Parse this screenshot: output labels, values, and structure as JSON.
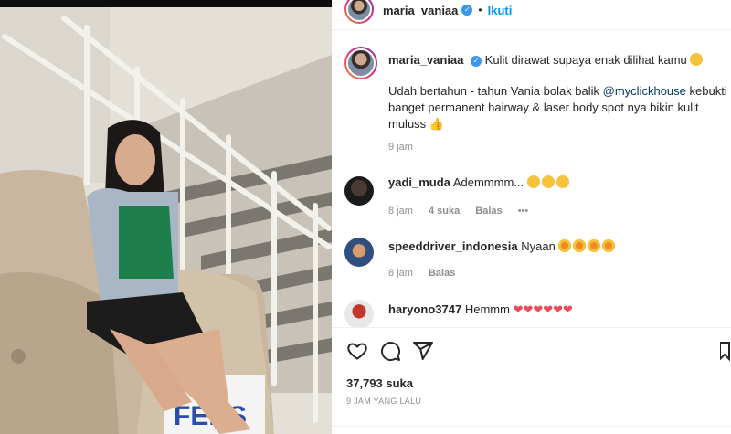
{
  "post": {
    "username": "maria_vaniaa",
    "follow_label": "Ikuti",
    "dot": "•",
    "caption_line1": "Kulit dirawat supaya enak dilihat kamu",
    "caption_p2_a": "Udah bertahun - tahun Vania bolak balik ",
    "caption_mention": "@myclickhouse",
    "caption_p2_b": " kebukti",
    "caption_line3": "banget permanent hairway & laser body spot nya bikin kulit",
    "caption_line4": "muluss",
    "caption_time": "9 jam",
    "likes": "37,793 suka",
    "posted": "9 JAM YANG LALU"
  },
  "comments": [
    {
      "user": "yadi_muda",
      "text": "Ademmmm...",
      "time": "8 jam",
      "likes": "4 suka",
      "reply": "Balas",
      "more": "•••"
    },
    {
      "user": "speeddriver_indonesia",
      "text": "Nyaan",
      "time": "8 jam",
      "reply": "Balas"
    },
    {
      "user": "haryono3747",
      "text": "Hemmm"
    }
  ],
  "photo": {
    "sign_text": "FERS"
  },
  "colors": {
    "accent": "#0095f6",
    "verified": "#3897f0",
    "heart": "#ed4956",
    "mention": "#00376b",
    "meta": "#8e8e8e"
  },
  "icons": [
    "verified-icon",
    "heart-icon",
    "comment-icon",
    "share-icon",
    "emoji-icon",
    "thumbs-up-icon",
    "more-icon",
    "save-icon"
  ]
}
